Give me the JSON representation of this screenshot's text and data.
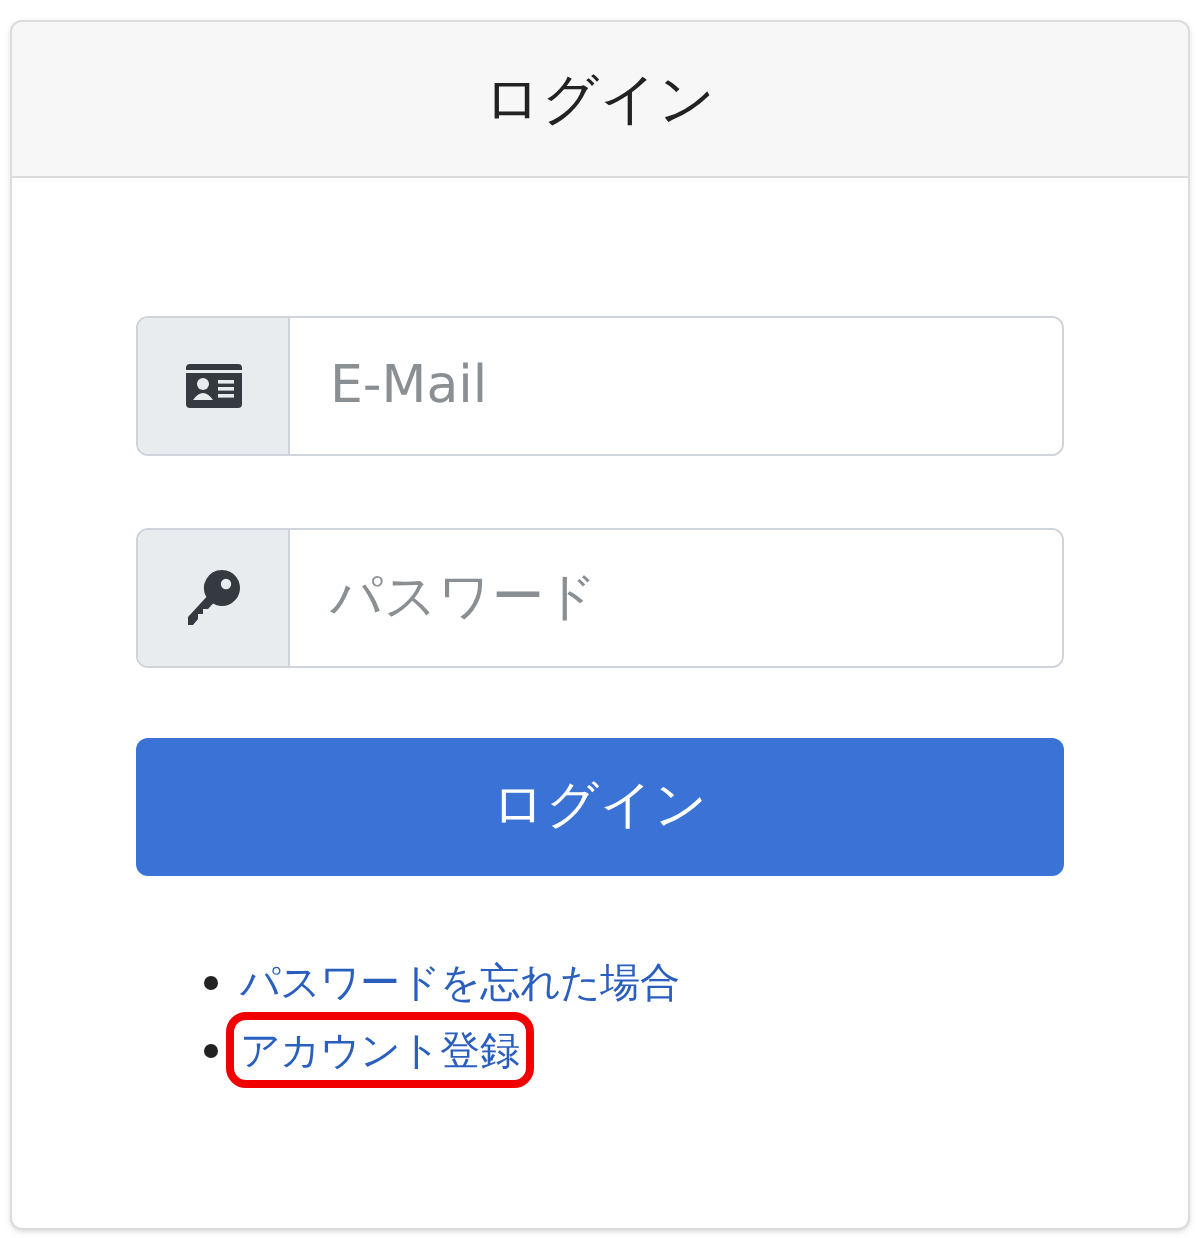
{
  "card": {
    "title": "ログイン"
  },
  "fields": [
    {
      "kind": "email",
      "placeholder": "E-Mail"
    },
    {
      "kind": "password",
      "placeholder": "パスワード"
    }
  ],
  "submit_button": "ログイン",
  "links": [
    {
      "label": "パスワードを忘れた場合",
      "highlighted": false
    },
    {
      "label": "アカウント登録",
      "highlighted": true
    }
  ]
}
